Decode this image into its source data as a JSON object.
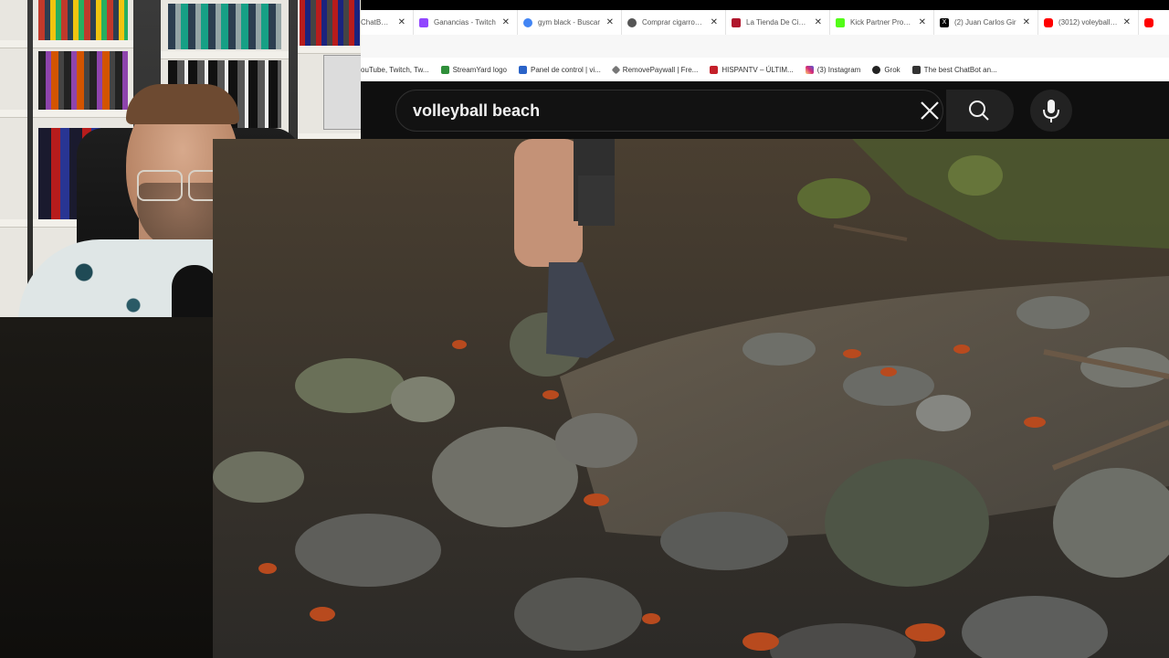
{
  "browser": {
    "tabs": [
      {
        "label": "ChatBot a",
        "favicon_color": "#111111"
      },
      {
        "label": "Ganancias - Twitch",
        "favicon_color": "#9146ff"
      },
      {
        "label": "gym black - Buscar",
        "favicon_color": "#4285f4"
      },
      {
        "label": "Comprar cigarros H",
        "favicon_color": "#555555"
      },
      {
        "label": "La Tienda De Cigar",
        "favicon_color": "#b0172d"
      },
      {
        "label": "Kick Partner Progra",
        "favicon_color": "#53fc18"
      },
      {
        "label": "(2) Juan Carlos Gir",
        "favicon_color": "#000000"
      },
      {
        "label": "(3012) voleyball - Y",
        "favicon_color": "#ff0000"
      }
    ],
    "bookmarks": [
      {
        "label": "ouTube, Twitch, Tw...",
        "favicon_color": "#ffffff"
      },
      {
        "label": "StreamYard logo",
        "favicon_color": "#2f8f3a"
      },
      {
        "label": "Panel de control | vi...",
        "favicon_color": "#2a63c8"
      },
      {
        "label": "RemovePaywall | Fre...",
        "favicon_color": "#777777"
      },
      {
        "label": "HISPANTV – ÚLTIM...",
        "favicon_color": "#c4202a"
      },
      {
        "label": "(3) Instagram",
        "favicon_color": "#d6249f"
      },
      {
        "label": "Grok",
        "favicon_color": "#222222"
      },
      {
        "label": "The best ChatBot an...",
        "favicon_color": "#333333"
      }
    ]
  },
  "youtube": {
    "search_value": "volleyball beach",
    "icons": {
      "clear": "close-icon",
      "search": "search-icon",
      "voice": "microphone-icon"
    }
  },
  "colors": {
    "yt_header_bg": "#0f0f0f",
    "search_border": "#303030",
    "text_light": "#f1f1f1"
  }
}
